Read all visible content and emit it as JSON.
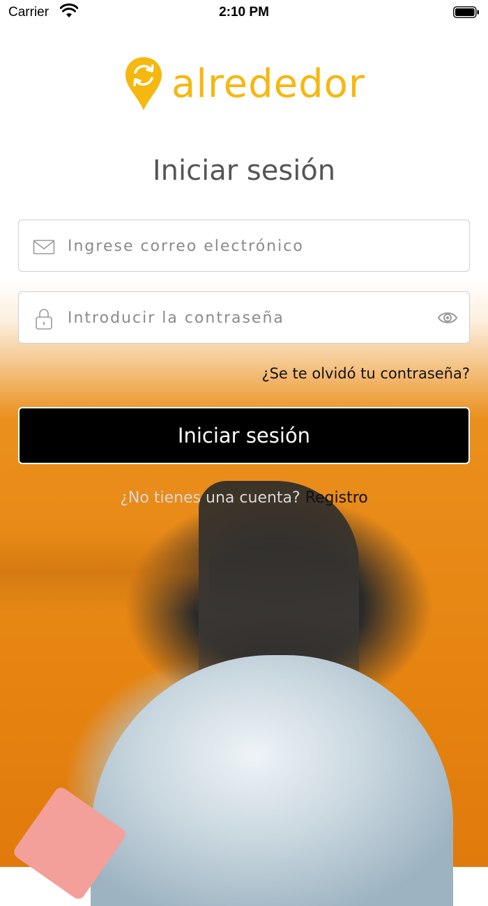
{
  "status_bar": {
    "carrier": "Carrier",
    "time": "2:10 PM"
  },
  "brand": {
    "name": "alrededor",
    "accent_color": "#f5b80f"
  },
  "login": {
    "title": "Iniciar sesión",
    "email_placeholder": "Ingrese correo electrónico",
    "email_value": "",
    "password_placeholder": "Introducir la contraseña",
    "password_value": "",
    "forgot_label": "¿Se te olvidó tu contraseña?",
    "submit_label": "Iniciar sesión",
    "no_account_text": "¿No tienes una cuenta?",
    "register_label": "Registro"
  },
  "icons": {
    "email": "envelope-icon",
    "password": "lock-icon",
    "toggle": "eye-icon"
  }
}
